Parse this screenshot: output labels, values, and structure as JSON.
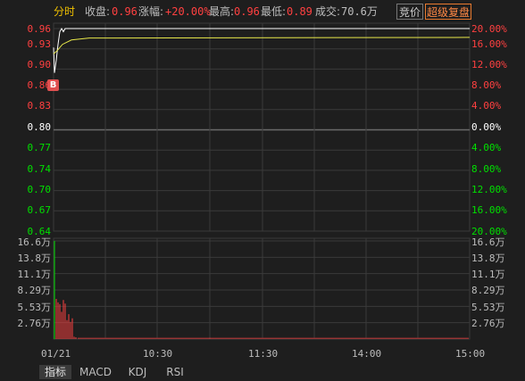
{
  "header": {
    "title": "分时",
    "close_label": "收盘:",
    "close_value": "0.96",
    "change_label": "涨幅:",
    "change_value": "+20.00%",
    "high_label": "最高:",
    "high_value": "0.96",
    "low_label": "最低:",
    "low_value": "0.89",
    "volume_label": "成交:",
    "volume_value": "70.6万"
  },
  "buttons": {
    "auction": "竞价",
    "super_level": "超级复盘"
  },
  "price_axis": [
    "0.96",
    "0.93",
    "0.90",
    "0.86",
    "0.83",
    "0.80",
    "0.77",
    "0.74",
    "0.70",
    "0.67",
    "0.64"
  ],
  "pct_axis": [
    "20.00%",
    "16.00%",
    "12.00%",
    "8.00%",
    "4.00%",
    "0.00%",
    "4.00%",
    "8.00%",
    "12.00%",
    "16.00%",
    "20.00%"
  ],
  "volume_axis": [
    "16.6万",
    "13.8万",
    "11.1万",
    "8.29万",
    "5.53万",
    "2.76万"
  ],
  "time_axis": [
    "01/21",
    "10:30",
    "11:30",
    "14:00",
    "15:00"
  ],
  "marker": "B",
  "tabs": [
    "指标",
    "MACD",
    "KDJ",
    "RSI"
  ],
  "colors": {
    "up": "#ff4040",
    "down": "#00e000",
    "flat": "#ffffff",
    "grid": "#3a3a3a",
    "price_line": "#ffffff",
    "avg_line": "#e8e84a",
    "title": "#f0c000"
  }
}
